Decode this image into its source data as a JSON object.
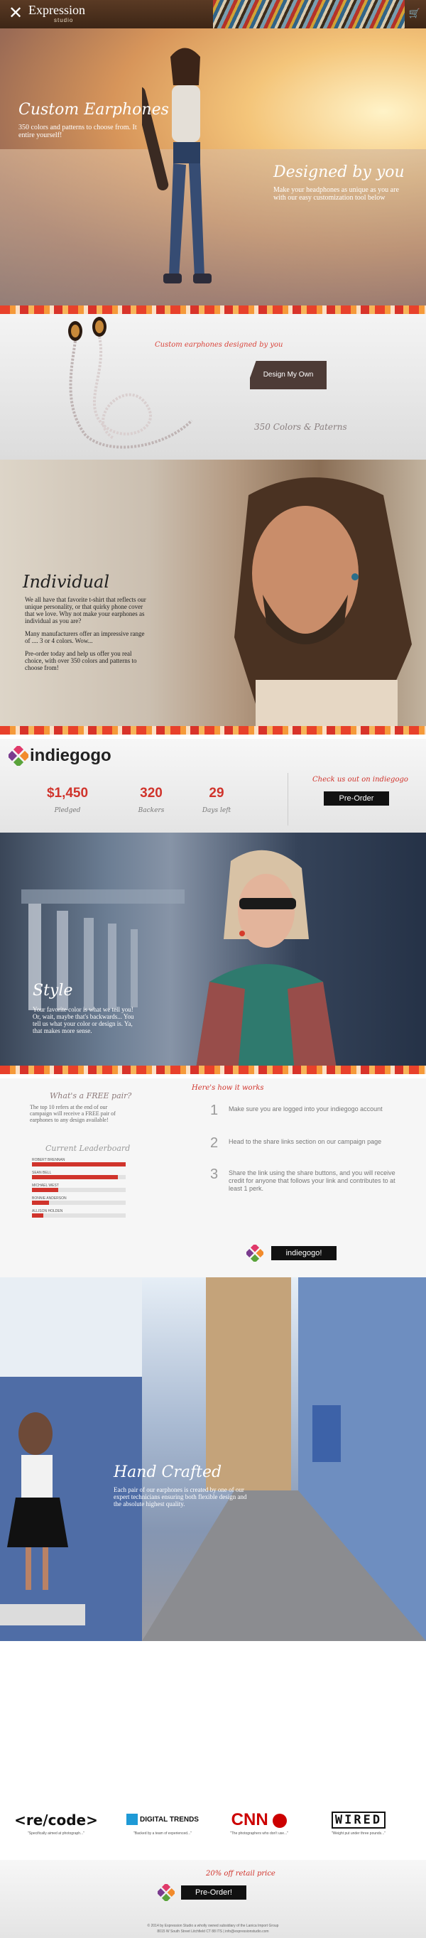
{
  "header": {
    "brand": "Expression",
    "brand_sub": "studio",
    "cart_icon": "cart-icon"
  },
  "hero": {
    "left_title": "Custom Earphones",
    "left_text": "350 colors and patterns to choose from. It entire yourself!",
    "right_title": "Designed by you",
    "right_text": "Make your headphones as unique as you are with our easy customization tool below"
  },
  "earphone": {
    "caption": "Custom earphones designed by you",
    "button": "Design My Own",
    "options": "350 Colors & Paterns"
  },
  "individual": {
    "title": "Individual",
    "paragraphs": [
      "We all have that favorite t-shirt that reflects our unique personality, or that quirky phone cover that we love. Why not make your earphones as individual as you are?",
      "Many manufacturers offer an impressive range of .... 3 or 4 colors. Wow...",
      "Pre-order today and help us offer you real choice, with over 350 colors and patterns to choose from!"
    ]
  },
  "indiegogo": {
    "name": "indiegogo",
    "stats": [
      {
        "value": "$1,450",
        "label": "Pledged"
      },
      {
        "value": "320",
        "label": "Backers"
      },
      {
        "value": "29",
        "label": "Days left"
      }
    ],
    "check_out": "Check us out on indiegogo",
    "button": "Pre-Order"
  },
  "style": {
    "title": "Style",
    "paragraphs": [
      "Your favorite color is what we tell you! Or, wait, maybe that's backwards... You tell us what your color or design is. Ya, that makes more sense."
    ]
  },
  "free_pair": {
    "title": "What's a FREE pair?",
    "text": "The top 10 refers at the end of our campaign will receive a FREE pair of earphones to any design available!",
    "leaderboard_title": "Current Leaderboard",
    "leaderboard": [
      {
        "name": "ROBERT BRENNAN",
        "fraction": 1.0
      },
      {
        "name": "SEAN BELL",
        "fraction": 0.92
      },
      {
        "name": "MICHAEL WEST",
        "fraction": 0.28
      },
      {
        "name": "BONNIE ANDERSON",
        "fraction": 0.18
      },
      {
        "name": "ALLISON HOLDEN",
        "fraction": 0.12
      }
    ],
    "how_title": "Here's how it works",
    "steps": [
      {
        "num": "1",
        "text": "Make sure you are logged into your indiegogo account"
      },
      {
        "num": "2",
        "text": "Head to the share links section on our campaign page"
      },
      {
        "num": "3",
        "text": "Share the link using the share buttons, and you will receive credit for anyone that follows your link and contributes to at least 1 perk."
      }
    ],
    "button": "indiegogo!"
  },
  "hand": {
    "title": "Hand Crafted",
    "text": "Each pair of our earphones is created by one of our expert technicians ensuring both flexible design and the absolute highest quality."
  },
  "press": [
    {
      "logo": "<re/code>",
      "quote": "\"Specifically aimed at photograph...\""
    },
    {
      "logo": "DIGITAL TRENDS",
      "quote": "\"Backed by a team of experienced...\""
    },
    {
      "logo": "CNN",
      "quote": "\"The photographers who don't use...\""
    },
    {
      "logo": "WIRED",
      "quote": "\"Weight put under three pounds...\""
    }
  ],
  "footer": {
    "offer": "20% off retail price",
    "button": "Pre-Order!",
    "line1": "© 2014 by Expression Studio a wholly owned subsidiary of the Lanica Import Group",
    "line2": "8015 W South Street Litchfield CT 88 ITS | info@expressionstudio.com"
  },
  "colors": {
    "accent": "#d0342c",
    "header": "#3d2616",
    "dark_button": "#111111"
  }
}
